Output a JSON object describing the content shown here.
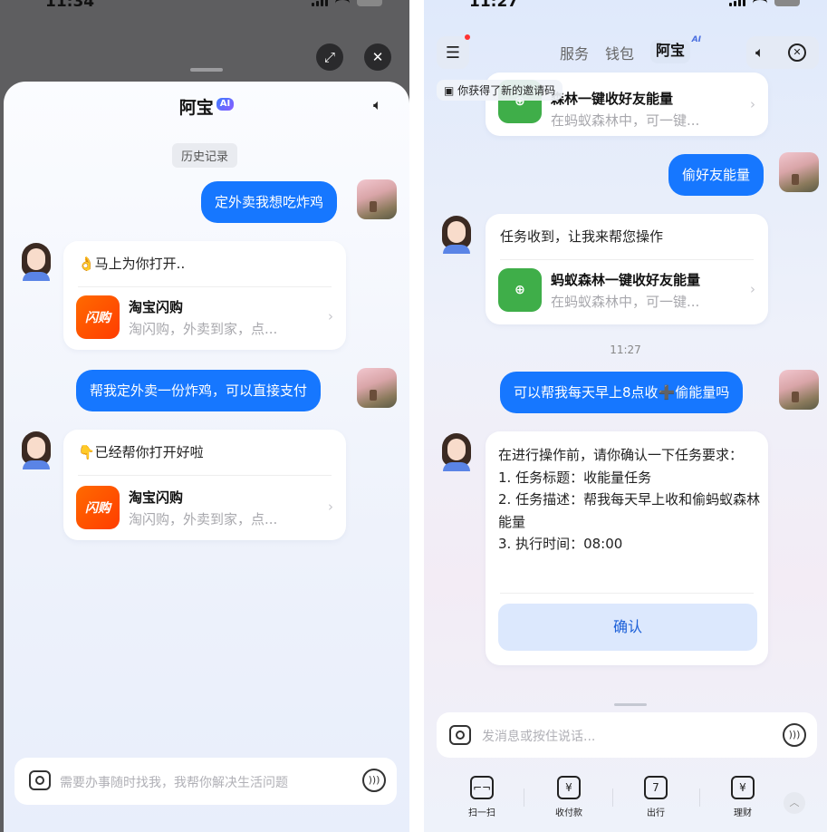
{
  "left": {
    "status_time": "11:34",
    "title": "阿宝",
    "ai_badge": "AI",
    "history_label": "历史记录",
    "messages": {
      "user1": "定外卖我想吃炸鸡",
      "bot1_text": "👌马上为你打开..",
      "bot1_app_name": "淘宝闪购",
      "bot1_app_desc": "淘闪购，外卖到家，点...",
      "user2": "帮我定外卖一份炸鸡，可以直接支付",
      "bot2_text": "👇已经帮你打开好啦",
      "bot2_app_name": "淘宝闪购",
      "bot2_app_desc": "淘闪购，外卖到家，点..."
    },
    "app_icon_text": "闪购",
    "input_placeholder": "需要办事随时找我，我帮你解决生活问题"
  },
  "right": {
    "status_time": "11:27",
    "tabs": [
      "服务",
      "钱包",
      "阿宝"
    ],
    "tab_ai": "AI",
    "toast": "你获得了新的邀请码",
    "top_card_name": "森林一键收好友能量",
    "top_card_desc": "在蚂蚁森林中，可一键...",
    "user1": "偷好友能量",
    "bot1_text": "任务收到，让我来帮您操作",
    "bot1_app_name": "蚂蚁森林一键收好友能量",
    "bot1_app_desc": "在蚂蚁森林中，可一键...",
    "timestamp": "11:27",
    "user2": "可以帮我每天早上8点收➕偷能量吗",
    "task_lines": [
      "在进行操作前，请你确认一下任务要求：",
      "1. 任务标题：收能量任务",
      "2. 任务描述：帮我每天早上收和偷蚂蚁森林能量",
      "3. 执行时间：08:00"
    ],
    "confirm_label": "确认",
    "input_placeholder": "发消息或按住说话...",
    "toolbar": [
      {
        "label": "扫一扫",
        "icon": "scan-icon",
        "glyph": "⌐¬"
      },
      {
        "label": "收付款",
        "icon": "payment-icon",
        "glyph": "¥"
      },
      {
        "label": "出行",
        "icon": "transit-icon",
        "glyph": "7"
      },
      {
        "label": "理财",
        "icon": "finance-icon",
        "glyph": "¥"
      }
    ]
  }
}
